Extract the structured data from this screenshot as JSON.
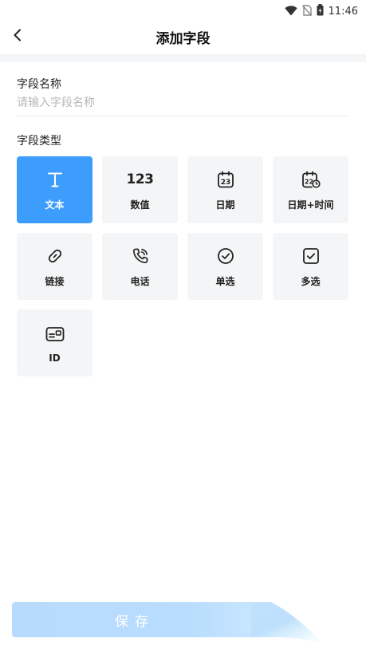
{
  "status_bar": {
    "time": "11:46"
  },
  "header": {
    "title": "添加字段"
  },
  "form": {
    "name_label": "字段名称",
    "name_value": "",
    "name_placeholder": "请输入字段名称",
    "type_label": "字段类型"
  },
  "field_types": [
    {
      "label": "文本",
      "icon": "text-icon",
      "selected": true
    },
    {
      "label": "数值",
      "icon": "number-icon",
      "glyph": "123",
      "selected": false
    },
    {
      "label": "日期",
      "icon": "calendar-icon",
      "selected": false
    },
    {
      "label": "日期+时间",
      "icon": "calendar-clock-icon",
      "selected": false
    },
    {
      "label": "链接",
      "icon": "link-icon",
      "selected": false
    },
    {
      "label": "电话",
      "icon": "phone-icon",
      "selected": false
    },
    {
      "label": "单选",
      "icon": "radio-check-icon",
      "selected": false
    },
    {
      "label": "多选",
      "icon": "checkbox-icon",
      "selected": false
    },
    {
      "label": "ID",
      "icon": "id-card-icon",
      "selected": false
    }
  ],
  "footer": {
    "save_label": "保存"
  },
  "colors": {
    "accent": "#3d9dfd",
    "card_bg": "#f4f5f6",
    "save_bg": "#b6dbfd"
  }
}
